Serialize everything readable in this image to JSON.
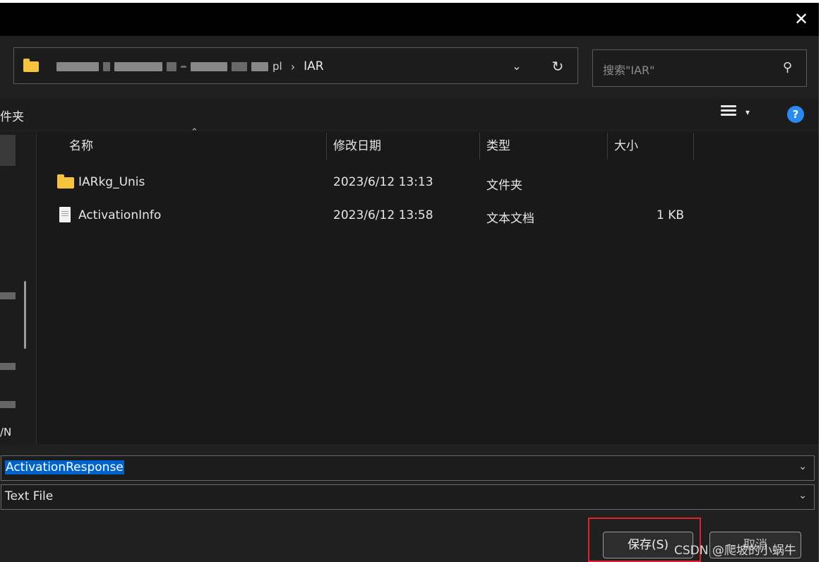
{
  "title_bar": {
    "close_glyph": "✕"
  },
  "address_bar": {
    "current_folder": "IAR",
    "partial_tail": "pl",
    "separator": "›",
    "dropdown_glyph": "⌄",
    "refresh_glyph": "↻"
  },
  "search": {
    "placeholder": "搜索\"IAR\"",
    "icon_glyph": "⚲"
  },
  "toolbar": {
    "new_folder_label": "件夹",
    "help_glyph": "?",
    "view_dropdown_glyph": "▾"
  },
  "nav_pane": {
    "fragment_text": "/N"
  },
  "columns": {
    "name": "名称",
    "modified": "修改日期",
    "type": "类型",
    "size": "大小",
    "sort_glyph": "⌃"
  },
  "files": [
    {
      "name": "IARkg_Unis",
      "modified": "2023/6/12 13:13",
      "type": "文件夹",
      "size": "",
      "kind": "folder-icon"
    },
    {
      "name": "ActivationInfo",
      "modified": "2023/6/12 13:58",
      "type": "文本文档",
      "size": "1 KB",
      "kind": "text-file-icon"
    }
  ],
  "file_name_field": {
    "value": "ActivationResponse",
    "dropdown_glyph": "⌄"
  },
  "file_type_field": {
    "value": "Text File",
    "dropdown_glyph": "⌄"
  },
  "buttons": {
    "save": "保存(S)",
    "cancel": "取消"
  },
  "watermark": "CSDN @爬坡的小蜗牛",
  "colors": {
    "accent": "#2a8af0",
    "selection": "#0063cc",
    "folder": "#f8c33c",
    "highlight": "#e0242c"
  }
}
